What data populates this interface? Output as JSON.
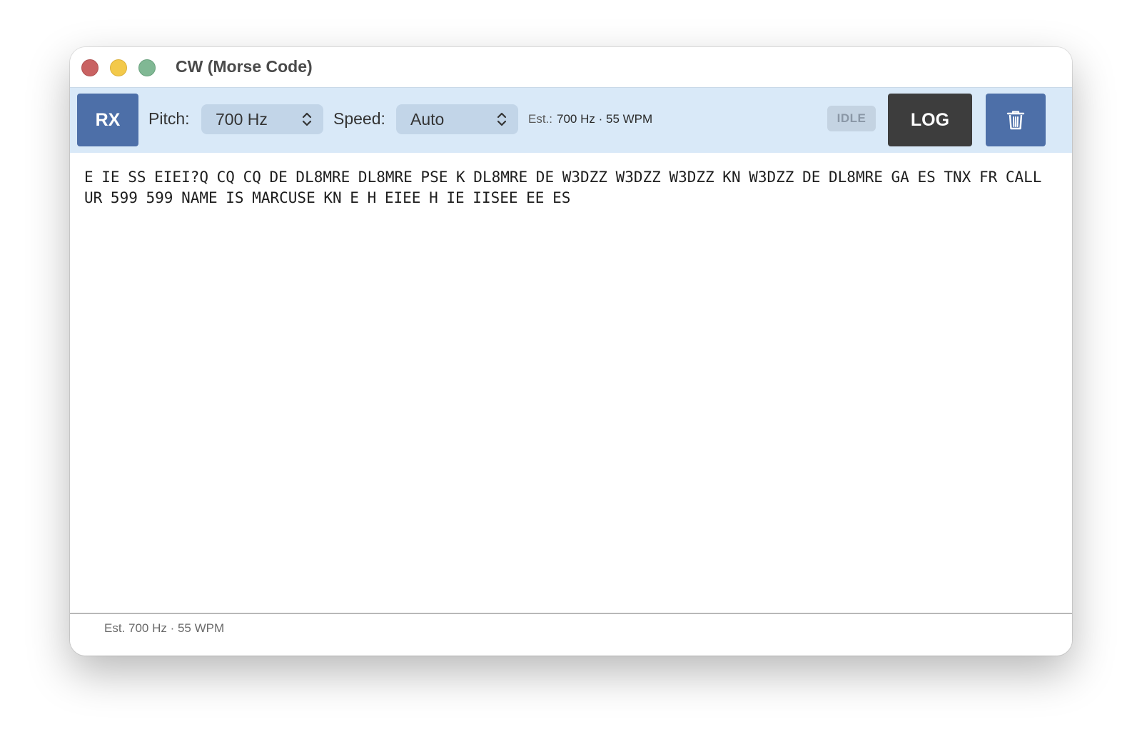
{
  "window": {
    "title": "CW (Morse Code)"
  },
  "toolbar": {
    "rx_label": "RX",
    "pitch_label": "Pitch:",
    "pitch_value": "700 Hz",
    "speed_label": "Speed:",
    "speed_value": "Auto",
    "est_label": "Est.:",
    "est_value": "700 Hz · 55 WPM",
    "status_badge": "IDLE",
    "log_label": "LOG",
    "clear_icon": "trash-icon"
  },
  "decoded": {
    "text": "E IE SS EIEI?Q CQ CQ DE DL8MRE DL8MRE PSE K DL8MRE DE W3DZZ W3DZZ W3DZZ KN W3DZZ DE DL8MRE GA ES TNX FR CALL UR 599 599 NAME IS MARCUSE KN E H EIEE H IE IISEE EE ES"
  },
  "statusbar": {
    "text": "Est. 700 Hz · 55 WPM"
  },
  "colors": {
    "toolbar_bg": "#d9e9f8",
    "rx_button": "#4d6fa8",
    "log_button": "#3d3d3d",
    "trash_button": "#4d6fa8",
    "traffic_close": "#c96262",
    "traffic_minimize": "#f3c94a",
    "traffic_maximize": "#80b894"
  }
}
